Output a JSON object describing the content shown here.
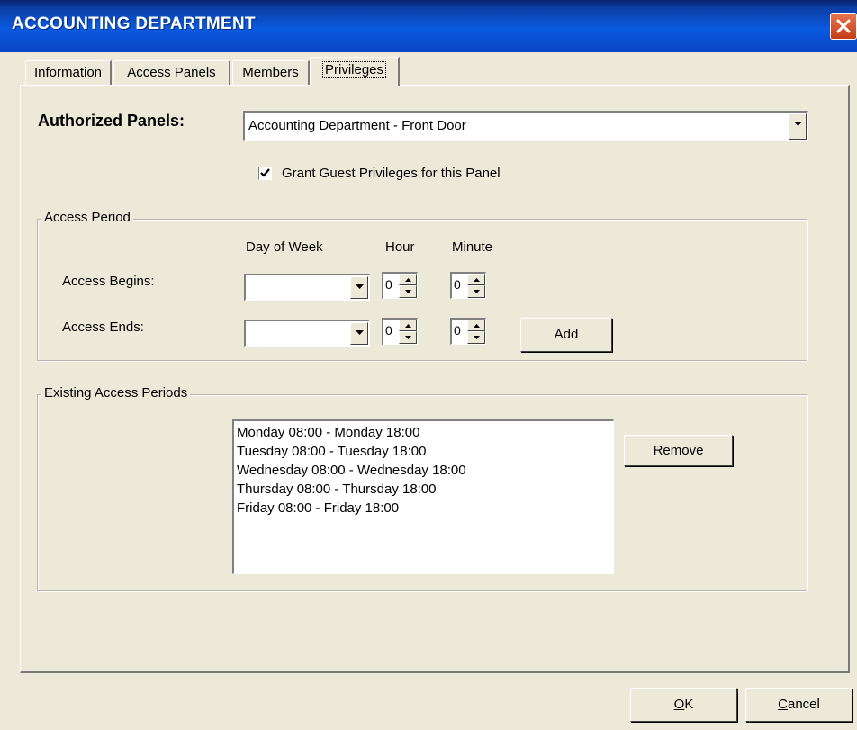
{
  "window": {
    "title": "ACCOUNTING DEPARTMENT"
  },
  "tabs": [
    {
      "label": "Information"
    },
    {
      "label": "Access Panels"
    },
    {
      "label": "Members"
    },
    {
      "label": "Privileges"
    }
  ],
  "privileges": {
    "authorized_panels_label": "Authorized Panels:",
    "authorized_panel_value": "Accounting Department - Front Door",
    "grant_guest_label": "Grant Guest Privileges for this Panel",
    "grant_guest_checked": true
  },
  "access_period": {
    "group_label": "Access Period",
    "col_day": "Day of Week",
    "col_hour": "Hour",
    "col_minute": "Minute",
    "begins_label": "Access Begins:",
    "ends_label": "Access Ends:",
    "begins_day": "",
    "begins_hour": "0",
    "begins_minute": "0",
    "ends_day": "",
    "ends_hour": "0",
    "ends_minute": "0",
    "add_label": "Add"
  },
  "existing": {
    "group_label": "Existing Access Periods",
    "periods": [
      "Monday 08:00 - Monday 18:00",
      "Tuesday 08:00 - Tuesday 18:00",
      "Wednesday 08:00 - Wednesday 18:00",
      "Thursday 08:00 - Thursday 18:00",
      "Friday 08:00 - Friday 18:00"
    ],
    "remove_label": "Remove"
  },
  "footer": {
    "ok_label": "OK",
    "ok_accel": "O",
    "ok_rest": "K",
    "cancel_label": "Cancel",
    "cancel_accel": "C",
    "cancel_rest": "ancel"
  },
  "colors": {
    "titlebar": "#0a5ae0",
    "face": "#ece9d8",
    "close": "#d5532b"
  },
  "icons": {
    "close": "close-icon",
    "dropdown": "dropdown-arrow-icon",
    "spin_up": "spin-up-icon",
    "spin_down": "spin-down-icon",
    "check": "checkmark-icon"
  }
}
